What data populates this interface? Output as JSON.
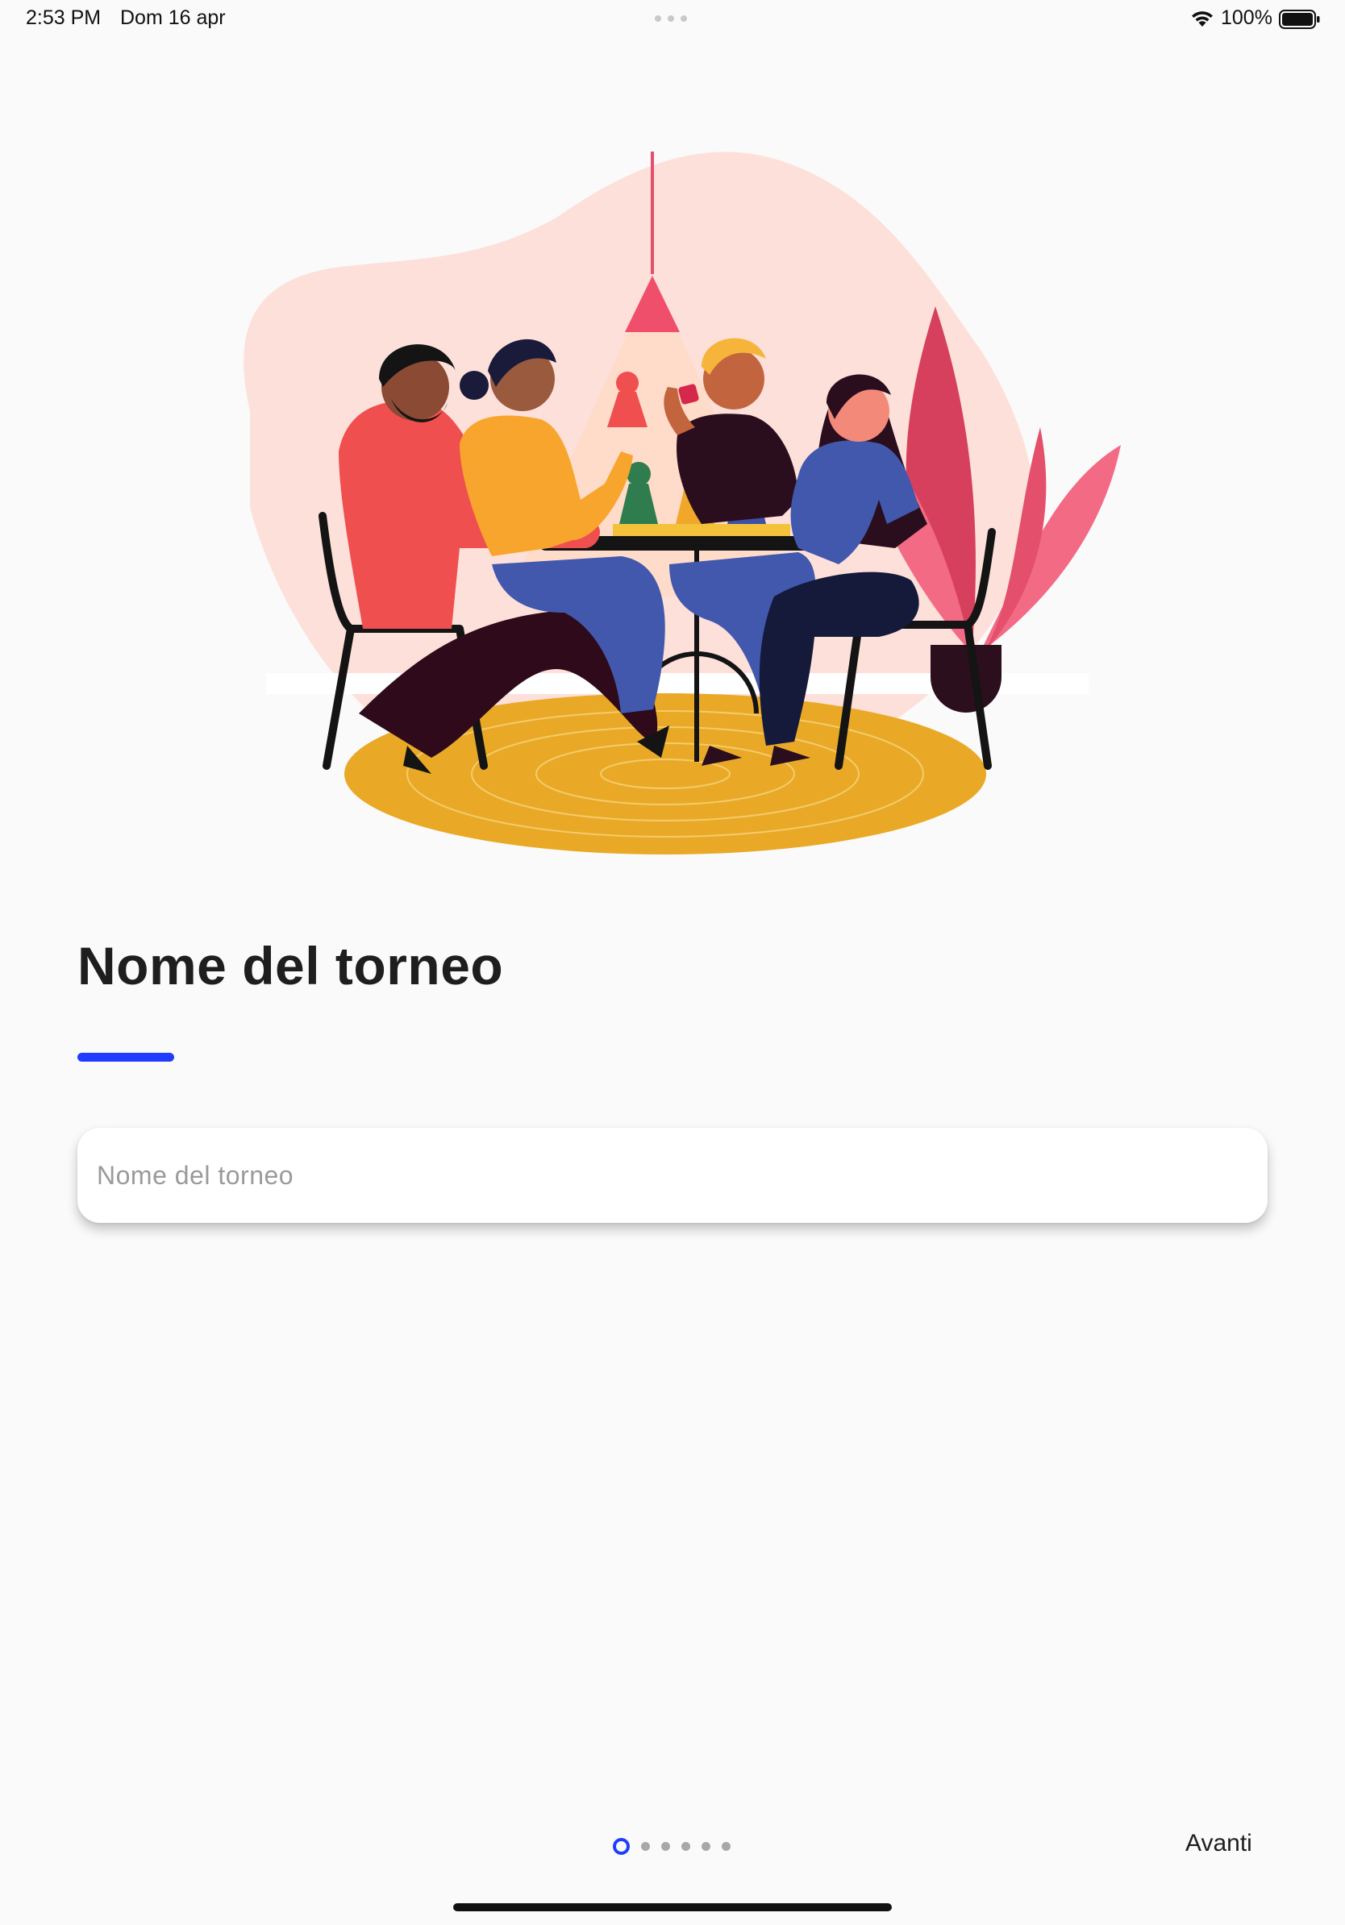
{
  "status_bar": {
    "time": "2:53 PM",
    "date": "Dom 16 apr",
    "battery": "100%",
    "icons": [
      "wifi-icon",
      "battery-icon"
    ]
  },
  "illustration": {
    "subject": "friends-playing-board-game"
  },
  "form": {
    "title": "Nome del torneo",
    "input_value": "",
    "input_placeholder": "Nome del torneo"
  },
  "pager": {
    "total_pages": 6,
    "current_page": 1
  },
  "nav": {
    "next_label": "Avanti"
  },
  "colors": {
    "accent": "#1f3cff",
    "background": "#fafafa",
    "rug": "#e9a926",
    "blob": "#fde0d9",
    "plant": "#e4506b"
  }
}
